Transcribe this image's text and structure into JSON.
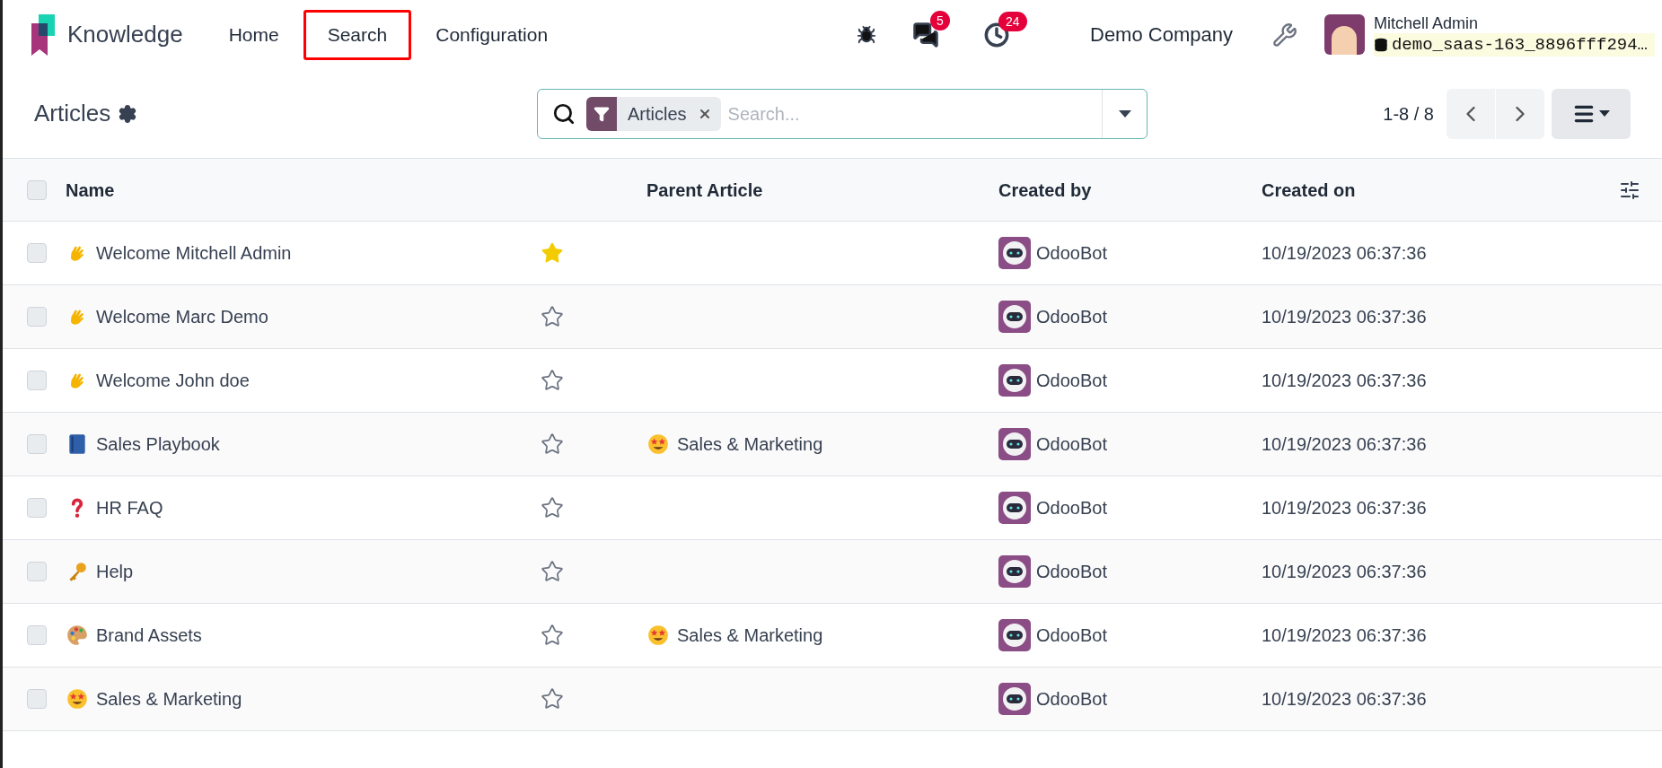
{
  "app": {
    "name": "Knowledge"
  },
  "menu": [
    {
      "label": "Home",
      "highlighted": false
    },
    {
      "label": "Search",
      "highlighted": true
    },
    {
      "label": "Configuration",
      "highlighted": false
    }
  ],
  "systray": {
    "messages_count": "5",
    "activities_count": "24",
    "company": "Demo Company",
    "user": "Mitchell Admin",
    "database": "demo_saas-163_8896fff294…"
  },
  "control_panel": {
    "title": "Articles",
    "facet": "Articles",
    "search_placeholder": "Search...",
    "pager": "1-8 / 8"
  },
  "table": {
    "columns": [
      "Name",
      "Parent Article",
      "Created by",
      "Created on"
    ],
    "select_all_checked": false,
    "rows": [
      {
        "kind": "wave",
        "checked": false,
        "name": "Welcome Mitchell Admin",
        "favorite": true,
        "parent": null,
        "created_by": "OdooBot",
        "created_on": "10/19/2023 06:37:36"
      },
      {
        "kind": "wave",
        "checked": false,
        "name": "Welcome Marc Demo",
        "favorite": false,
        "parent": null,
        "created_by": "OdooBot",
        "created_on": "10/19/2023 06:37:36"
      },
      {
        "kind": "wave",
        "checked": false,
        "name": "Welcome John doe",
        "favorite": false,
        "parent": null,
        "created_by": "OdooBot",
        "created_on": "10/19/2023 06:37:36"
      },
      {
        "kind": "book",
        "checked": false,
        "name": "Sales Playbook",
        "favorite": false,
        "parent": {
          "kind": "starstruck",
          "name": "Sales & Marketing"
        },
        "created_by": "OdooBot",
        "created_on": "10/19/2023 06:37:36"
      },
      {
        "kind": "question",
        "checked": false,
        "name": "HR FAQ",
        "favorite": false,
        "parent": null,
        "created_by": "OdooBot",
        "created_on": "10/19/2023 06:37:36"
      },
      {
        "kind": "key",
        "checked": false,
        "name": "Help",
        "favorite": false,
        "parent": null,
        "created_by": "OdooBot",
        "created_on": "10/19/2023 06:37:36"
      },
      {
        "kind": "palette",
        "checked": false,
        "name": "Brand Assets",
        "favorite": false,
        "parent": {
          "kind": "starstruck",
          "name": "Sales & Marketing"
        },
        "created_by": "OdooBot",
        "created_on": "10/19/2023 06:37:36"
      },
      {
        "kind": "starstruck",
        "checked": false,
        "name": "Sales & Marketing",
        "favorite": false,
        "parent": null,
        "created_by": "OdooBot",
        "created_on": "10/19/2023 06:37:36"
      }
    ]
  }
}
